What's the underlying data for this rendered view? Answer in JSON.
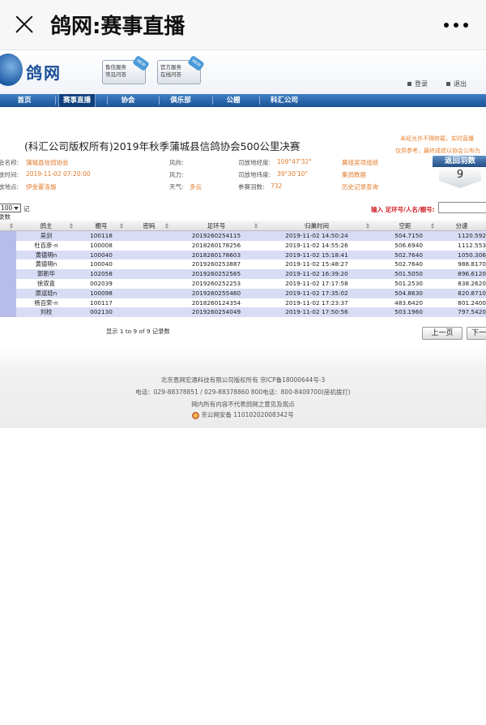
{
  "wechat": {
    "title": "鸽网:赛事直播"
  },
  "site": {
    "logo": "鸽网",
    "header_buttons": [
      {
        "line1": "售信服务",
        "line2": "常见问答",
        "tag": "NEW"
      },
      {
        "line1": "官方服务",
        "line2": "在线问答",
        "tag": "NEW"
      }
    ],
    "login": "登录",
    "logout": "退出"
  },
  "nav": {
    "items": [
      "首页",
      "赛事直播",
      "协会",
      "俱乐部",
      "公棚",
      "科汇公司"
    ],
    "active_index": 1
  },
  "race": {
    "title": "(科汇公司版权所有)2019年秋季蒲城县信鸽协会500公里决赛",
    "notice_line1": "未经允许不得转载，实时直播",
    "notice_line2": "仅供参考，最终成绩以协会公布为",
    "fields": {
      "org_label": "会名称:",
      "org_value": "蒲城县信鸽协会",
      "time_label": "放时间:",
      "time_value": "2019-11-02 07:20:00",
      "place_label": "放地点:",
      "place_value": "伊金霍洛旗",
      "wind_dir_label": "风向:",
      "wind_force_label": "风力:",
      "weather_label": "天气:",
      "weather_value": "多云",
      "lon_label": "司放地经度:",
      "lon_value": "109°47'32\"",
      "lat_label": "司放地纬度:",
      "lat_value": "39°30'10\"",
      "count_label": "参赛羽数:",
      "count_value": "732"
    },
    "links": [
      "赛组奖项成绩",
      "集鸽数据",
      "历史记录查询"
    ],
    "return_badge": {
      "label": "返回羽数",
      "value": "9"
    }
  },
  "controls": {
    "page_size": "100",
    "page_size_tail": "记",
    "records_label": "录数",
    "search_label": "输入 足环号/人名/棚号:",
    "search_value": ""
  },
  "table": {
    "columns": [
      "鸽主",
      "棚号",
      "密码",
      "足环号",
      "归巢时间",
      "空距",
      "分速"
    ],
    "rows": [
      [
        "吴剑",
        "100118",
        "",
        "2019260254115",
        "2019-11-02 14:50:24",
        "504.7150",
        "1120.592"
      ],
      [
        "杜百彦-n",
        "100008",
        "",
        "2018260178256",
        "2019-11-02 14:55:26",
        "506.6940",
        "1112.553"
      ],
      [
        "黄德明n",
        "100040",
        "",
        "2018260178603",
        "2019-11-02 15:18:41",
        "502.7640",
        "1050.306"
      ],
      [
        "黄德明n",
        "100040",
        "",
        "2019260253887",
        "2019-11-02 15:48:27",
        "502.7640",
        "988.8170"
      ],
      [
        "郭新华",
        "102058",
        "",
        "2019260252565",
        "2019-11-02 16:39:20",
        "501.5050",
        "896.6120"
      ],
      [
        "徐双喜",
        "002039",
        "",
        "2019260252253",
        "2019-11-02 17:17:58",
        "501.2530",
        "838.2620"
      ],
      [
        "原逗娃n",
        "100098",
        "",
        "2019260255460",
        "2019-11-02 17:35:02",
        "504.8630",
        "820.8710"
      ],
      [
        "杨百荣-n",
        "100117",
        "",
        "2018260124354",
        "2019-11-02 17:23:37",
        "483.6420",
        "801.2400"
      ],
      [
        "刘校",
        "002130",
        "",
        "2019260254049",
        "2019-11-02 17:50:56",
        "503.1960",
        "797.5420"
      ]
    ],
    "pager_info": "显示 1 to 9 of 9 记录数",
    "prev": "上一页",
    "next": "下一"
  },
  "footer": {
    "line1": "北京恩网宏通科技有限公司版权所有 京ICP备18000644号-3",
    "line2": "电话：029-88378851 / 029-88378860   800电话：800-8409700(座机拨打)",
    "line3": "网内所有内容不代表鸽网之意见及观点",
    "line4": "京公网安备 11010202008342号"
  }
}
